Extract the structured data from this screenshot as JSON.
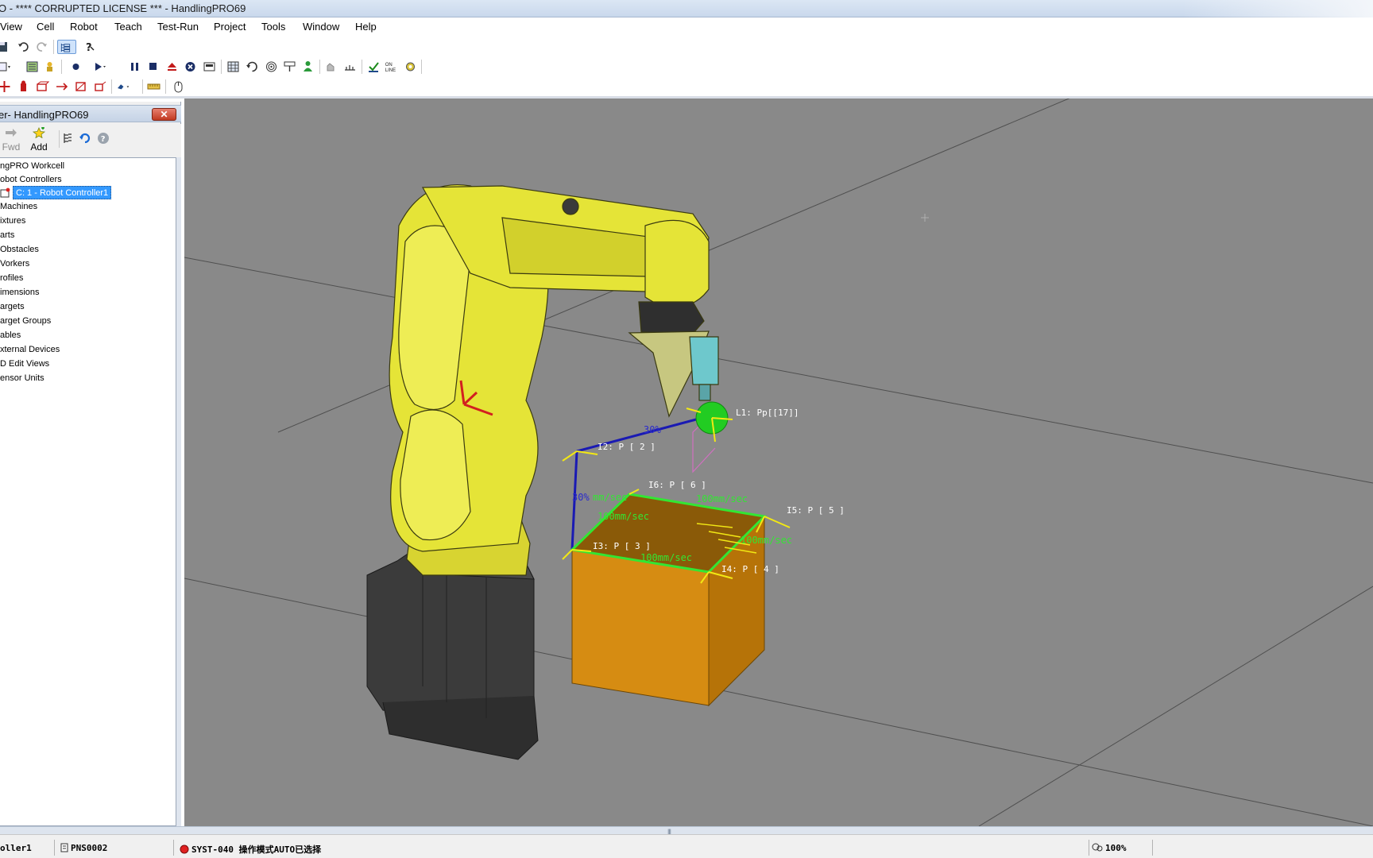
{
  "window": {
    "title": "O - **** CORRUPTED LICENSE *** - HandlingPRO69"
  },
  "menu": [
    "View",
    "Cell",
    "Robot",
    "Teach",
    "Test-Run",
    "Project",
    "Tools",
    "Window",
    "Help"
  ],
  "toolbar": {
    "row1": [
      "save-icon",
      "undo-icon",
      "redo-icon",
      "cell-browser-icon",
      "help-icon"
    ],
    "row2": [
      "process-icon",
      "teach-icon",
      "robot-icon",
      "record-icon",
      "play-icon",
      "pause-icon",
      "stop-icon",
      "eject-icon",
      "abort-icon",
      "tp-icon",
      "grid-icon",
      "refresh-icon",
      "target-icon",
      "label-icon",
      "worker-icon",
      "hand-icon",
      "measure-icon",
      "check-icon",
      "online-icon",
      "gear-icon"
    ],
    "online_label": "ON\nLINE"
  },
  "panel": {
    "title": "er- HandlingPRO69",
    "close_label": "✕",
    "tools": {
      "fwd_label": "Fwd",
      "add_label": "Add"
    },
    "tree": [
      "ngPRO Workcell",
      "obot Controllers",
      "C: 1 - Robot Controller1",
      "Machines",
      "ixtures",
      "arts",
      "Obstacles",
      "Vorkers",
      "rofiles",
      "imensions",
      "argets",
      "arget Groups",
      "ables",
      "xternal Devices",
      "D Edit Views",
      "ensor Units"
    ]
  },
  "viewport": {
    "labels": {
      "p1": "L1: Pp[[17]]",
      "p2": "I2: P [ 2 ]",
      "p3": "I3: P [ 3 ]",
      "p4": "I4: P [ 4 ]",
      "p5": "I5: P [ 5 ]",
      "p6": "I6: P [ 6 ]",
      "pct1": "30%",
      "pct2": "30%",
      "spd1": "100mm/sec",
      "spd2": "100mm/sec",
      "spd3": "100mm/sec",
      "spd4": "100mm/sec",
      "spd5": "mm/sec"
    },
    "colors": {
      "background": "#898989",
      "robot": "#e5e437",
      "base": "#3d3d3d",
      "box": "#d68c12",
      "path_green": "#33e633",
      "path_blue": "#1a1ab3",
      "ball": "#22cc22"
    }
  },
  "status": {
    "controller": "oller1",
    "program": "PNS0002",
    "message": "SYST-040 操作模式AUTO已选择",
    "zoom": "100%"
  }
}
